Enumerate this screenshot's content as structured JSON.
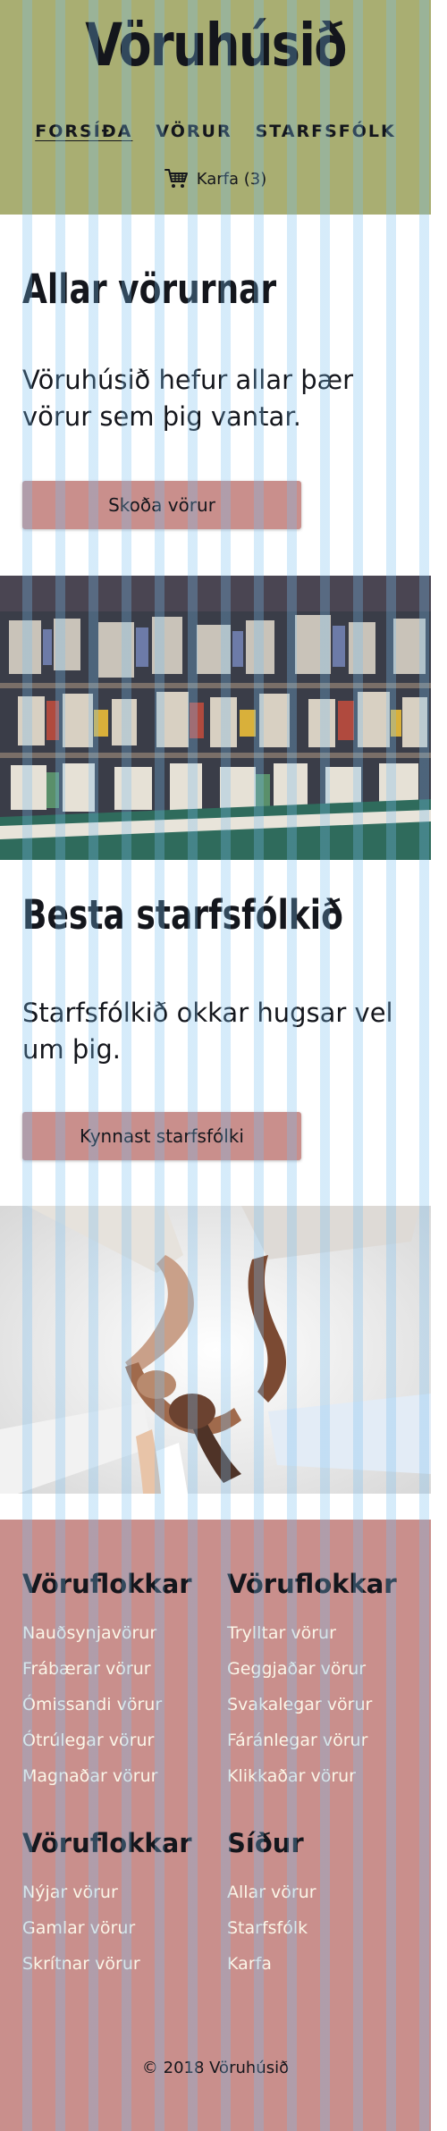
{
  "header": {
    "site_title": "Vöruhúsið",
    "nav": [
      {
        "label": "FORSÍÐA",
        "active": true
      },
      {
        "label": "VÖRUR",
        "active": false
      },
      {
        "label": "STARFSFÓLK",
        "active": false
      }
    ],
    "cart_label": "Karfa (3)"
  },
  "sections": [
    {
      "title": "Allar vörurnar",
      "text": "Vöruhúsið hefur allar þær vörur sem þig vantar.",
      "button": "Skoða vörur"
    },
    {
      "title": "Besta starfsfólkið",
      "text": "Starfsfólkið okkar hugsar vel um þig.",
      "button": "Kynnast starfsfólki"
    }
  ],
  "footer": {
    "columns": [
      {
        "heading": "Vöruflokkar",
        "links": [
          "Nauðsynjavörur",
          "Frábærar vörur",
          "Ómissandi vörur",
          "Ótrúlegar vörur",
          "Magnaðar vörur"
        ]
      },
      {
        "heading": "Vöruflokkar",
        "links": [
          "Trylltar vörur",
          "Geggjaðar vörur",
          "Svakalegar vörur",
          "Fáránlegar vörur",
          "Klikkaðar vörur"
        ]
      },
      {
        "heading": "Vöruflokkar",
        "links": [
          "Nýjar vörur",
          "Gamlar vörur",
          "Skrítnar vörur"
        ]
      },
      {
        "heading": "Síður",
        "links": [
          "Allar vörur",
          "Starfsfólk",
          "Karfa"
        ]
      }
    ],
    "copyright": "© 2018 Vöruhúsið"
  },
  "colors": {
    "header_bg": "#a9ae72",
    "accent": "#c98f8c",
    "text_dark": "#14161c",
    "footer_link": "#fbf6e8",
    "grid_stripe": "#78bef0"
  },
  "icons": {
    "cart": "shopping-cart-icon"
  }
}
